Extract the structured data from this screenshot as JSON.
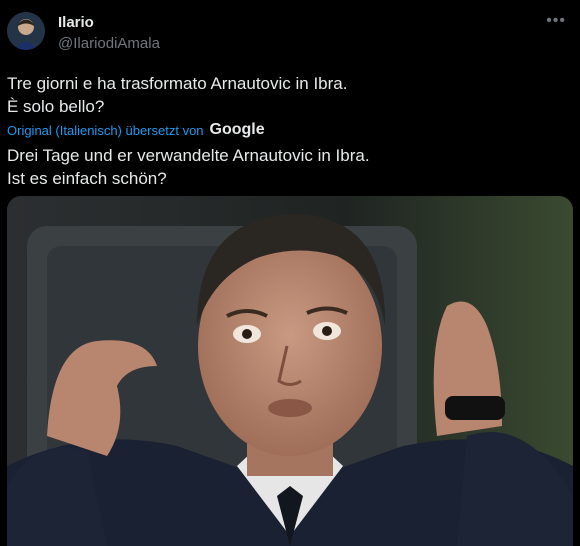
{
  "author": {
    "name": "Ilario",
    "handle": "@IlariodiAmala"
  },
  "icons": {
    "more": "more-horizontal-icon",
    "avatar": "avatar-image"
  },
  "tweet": {
    "original_line1": "Tre giorni e ha trasformato Arnautovic in Ibra.",
    "original_line2": "È solo bello?",
    "translation_note": "Original (Italienisch) übersetzt von",
    "translation_provider": "Google",
    "translated_line1": "Drei Tage und er verwandelte Arnautovic in Ibra.",
    "translated_line2": "Ist es einfach schön?"
  },
  "colors": {
    "background": "#000000",
    "text": "#e7e9ea",
    "secondary": "#71767b",
    "link": "#1d9bf0"
  }
}
